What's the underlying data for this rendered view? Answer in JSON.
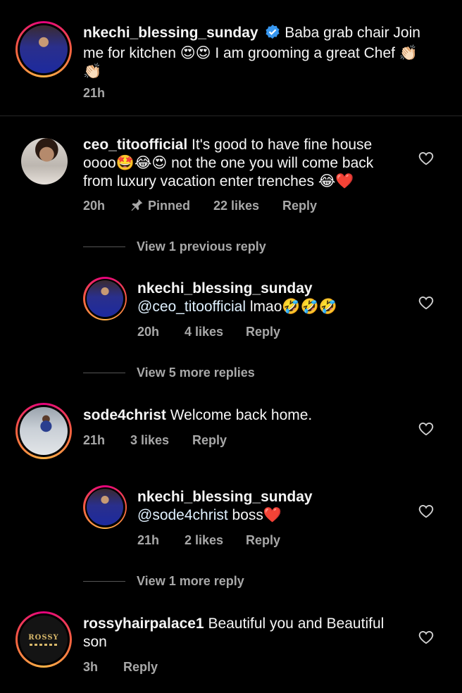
{
  "caption": {
    "username": "nkechi_blessing_sunday",
    "text": " Baba grab chair Join me for kitchen 😍😍 I am grooming a great Chef 👏🏻👏🏻",
    "time": "21h"
  },
  "comments": [
    {
      "username": "ceo_titoofficial",
      "text": " It's good to have fine house oooo🤩😂😍 not the one you will come back from luxury vacation enter trenches 😂❤️",
      "time": "20h",
      "pinned_label": "Pinned",
      "likes": "22 likes",
      "reply_label": "Reply",
      "view_replies": "View 1 previous reply"
    },
    {
      "username": "nkechi_blessing_sunday",
      "mention": "@ceo_titoofficial",
      "text": " lmao🤣🤣🤣",
      "time": "20h",
      "likes": "4 likes",
      "reply_label": "Reply",
      "view_replies": "View 5 more replies"
    },
    {
      "username": "sode4christ",
      "text": " Welcome back home.",
      "time": "21h",
      "likes": "3 likes",
      "reply_label": "Reply"
    },
    {
      "username": "nkechi_blessing_sunday",
      "mention": "@sode4christ",
      "text": " boss❤️",
      "time": "21h",
      "likes": "2 likes",
      "reply_label": "Reply",
      "view_replies": "View 1 more reply"
    },
    {
      "username": "rossyhairpalace1",
      "text": " Beautiful you and Beautiful son",
      "time": "3h",
      "reply_label": "Reply",
      "logo_text": "ROSSY"
    }
  ],
  "colors": {
    "background": "#000000",
    "verified": "#3797f0",
    "muted": "#a8a8a8",
    "heart_red": "#e0245e"
  },
  "icons": [
    "verified-badge-icon",
    "pin-icon",
    "heart-outline-icon"
  ]
}
